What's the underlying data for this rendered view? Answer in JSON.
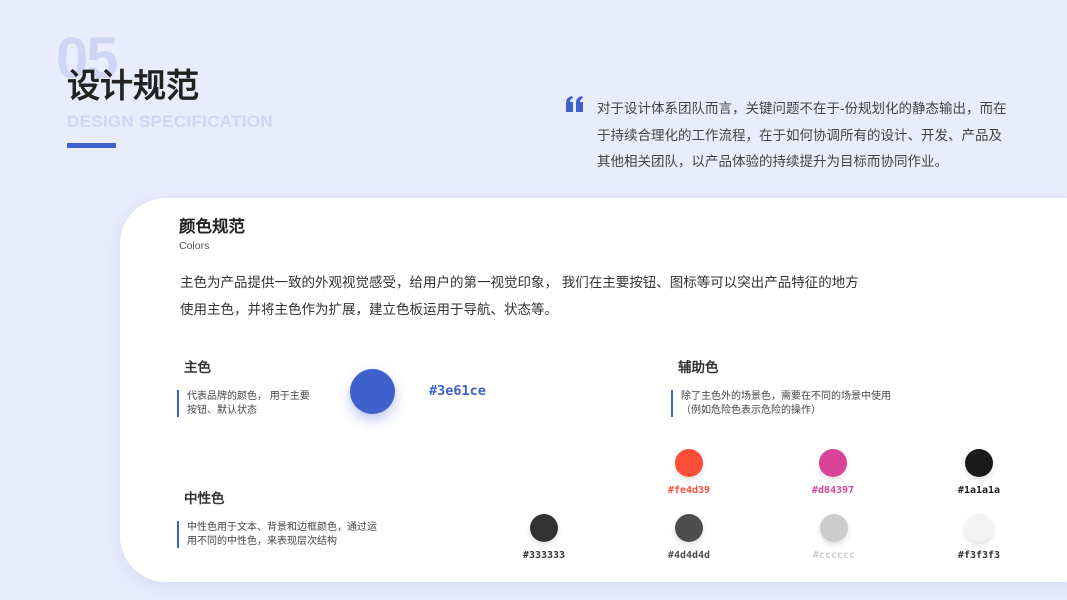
{
  "header": {
    "section_number": "05",
    "title": "设计规范",
    "subtitle": "DESIGN SPECIFICATION",
    "quote_icon": "quote-mark-icon",
    "quote_text": "对于设计体系团队而言，关键问题不在于-份规划化的静态输出，而在于持续合理化的工作流程，在于如何协调所有的设计、开发、产品及其他相关团队，以产品体验的持续提升为目标而协同作业。"
  },
  "card": {
    "title": "颜色规范",
    "subtitle": "Colors",
    "description": "主色为产品提供一致的外观视觉感受，给用户的第一视觉印象， 我们在主要按钮、图标等可以突出产品特征的地方使用主色，并将主色作为扩展，建立色板运用于导航、状态等。",
    "primary": {
      "label": "主色",
      "description": "代表品牌的颜色， 用于主要按钮、默认状态",
      "color": "#3e61ce",
      "hex": "#3e61ce"
    },
    "secondary": {
      "label": "辅助色",
      "description": "除了主色外的场景色，需要在不同的场景中使用（例如危险色表示危险的操作）",
      "swatches": [
        {
          "color": "#fe4d39",
          "hex": "#fe4d39",
          "text_color": "#fe4d39"
        },
        {
          "color": "#d84397",
          "hex": "#d84397",
          "text_color": "#d84397"
        },
        {
          "color": "#1a1a1a",
          "hex": "#1a1a1a",
          "text_color": "#1a1a1a"
        }
      ]
    },
    "neutral": {
      "label": "中性色",
      "description": "中性色用于文本、背景和边框颜色，通过运用不同的中性色，来表现层次结构",
      "swatches": [
        {
          "color": "#333333",
          "hex": "#333333",
          "text_color": "#333333"
        },
        {
          "color": "#4d4d4d",
          "hex": "#4d4d4d",
          "text_color": "#4d4d4d"
        },
        {
          "color": "#cccccc",
          "hex": "#cccccc",
          "text_color": "#cccccc"
        },
        {
          "color": "#f3f3f3",
          "hex": "#f3f3f3",
          "text_color": "#333333"
        }
      ]
    }
  }
}
